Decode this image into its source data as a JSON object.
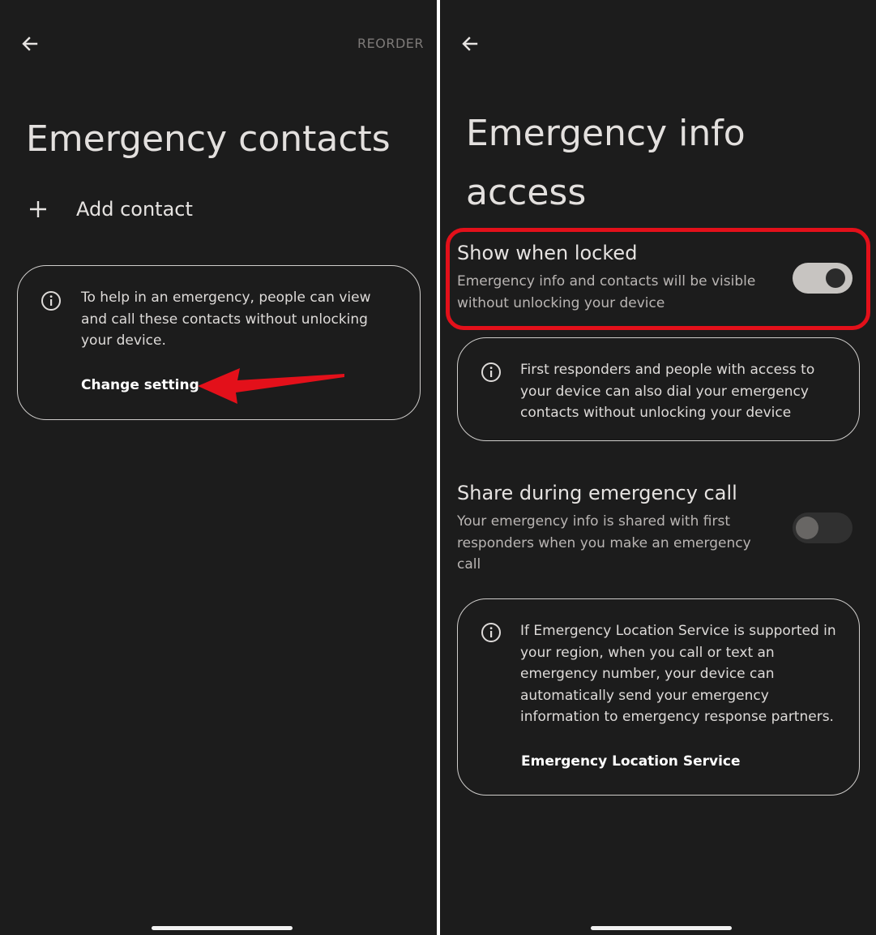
{
  "left_screen": {
    "reorder_label": "REORDER",
    "title": "Emergency contacts",
    "add_contact_label": "Add contact",
    "info_card": {
      "text": "To help in an emergency, people can view and call these contacts without unlocking your device.",
      "link_label": "Change setting"
    },
    "annotation_arrow_color": "#e3101a"
  },
  "right_screen": {
    "title": "Emergency info access",
    "show_when_locked": {
      "title": "Show when locked",
      "subtitle": "Emergency info and contacts will be visible without unlocking your device",
      "enabled": true
    },
    "responders_card": {
      "text": "First responders and people with access to your device can also dial your emergency contacts without unlocking your device"
    },
    "share_during_call": {
      "title": "Share during emergency call",
      "subtitle": "Your emergency info is shared with first responders when you make an emergency call",
      "enabled": false
    },
    "els_card": {
      "text": "If Emergency Location Service is supported in your region, when you call or text an emergency number, your device can automatically send your emergency information to emergency response partners.",
      "link_label": "Emergency Location Service"
    },
    "highlight_color": "#e3101a"
  },
  "icons": [
    "back-arrow-icon",
    "plus-icon",
    "info-icon"
  ],
  "colors": {
    "background": "#1c1c1c",
    "divider": "#ffffff",
    "text_primary": "#e6e3e1",
    "text_secondary": "#b9b5b3",
    "annotation_red": "#e3101a"
  }
}
